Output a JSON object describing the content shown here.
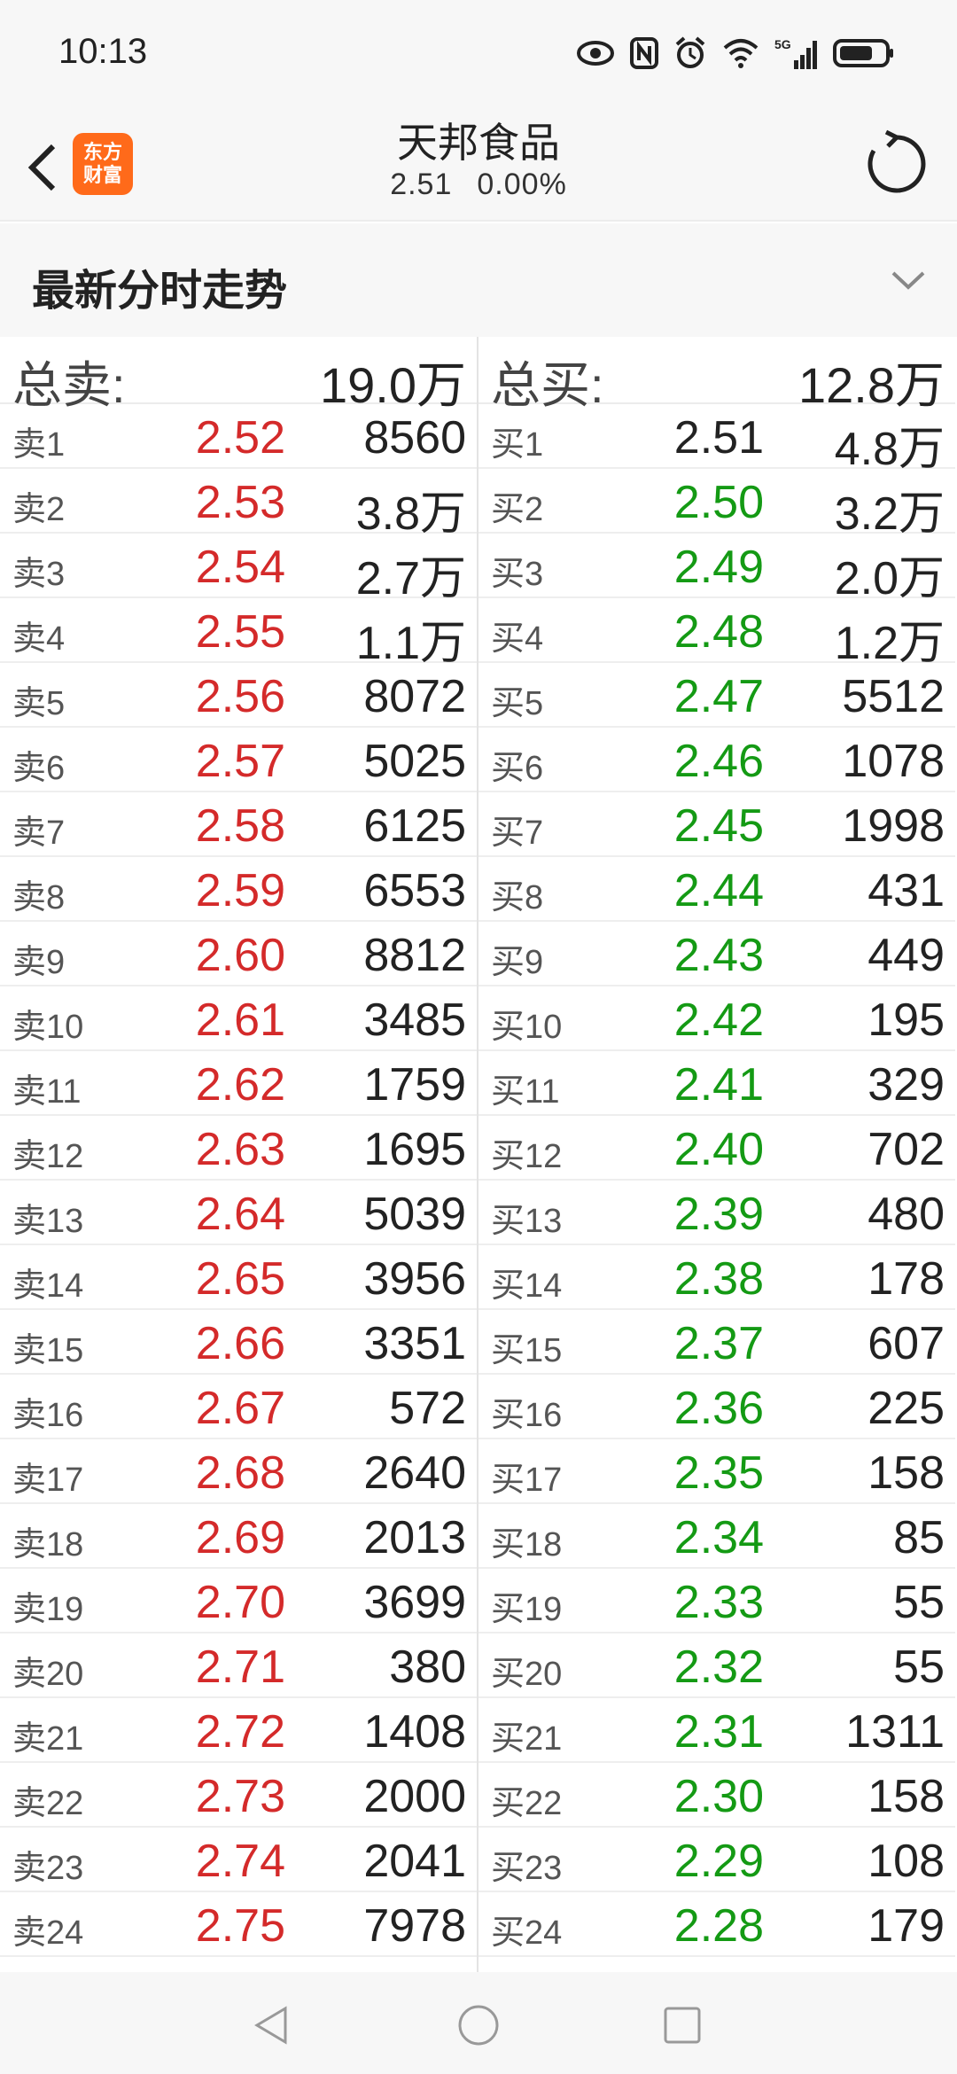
{
  "status_bar": {
    "time": "10:13",
    "icons": [
      "eye-icon",
      "nfc-icon",
      "alarm-icon",
      "wifi-icon",
      "signal-5g-icon",
      "battery-icon"
    ]
  },
  "header": {
    "logo_line1": "东方",
    "logo_line2": "财富",
    "stock_name": "天邦食品",
    "price": "2.51",
    "change_pct": "0.00%"
  },
  "section": {
    "title": "最新分时走势"
  },
  "order_book": {
    "sell_total_label": "总卖:",
    "sell_total_value": "19.0万",
    "buy_total_label": "总买:",
    "buy_total_value": "12.8万",
    "sell": [
      {
        "label": "卖1",
        "price": "2.52",
        "volume": "8560"
      },
      {
        "label": "卖2",
        "price": "2.53",
        "volume": "3.8万"
      },
      {
        "label": "卖3",
        "price": "2.54",
        "volume": "2.7万"
      },
      {
        "label": "卖4",
        "price": "2.55",
        "volume": "1.1万"
      },
      {
        "label": "卖5",
        "price": "2.56",
        "volume": "8072"
      },
      {
        "label": "卖6",
        "price": "2.57",
        "volume": "5025"
      },
      {
        "label": "卖7",
        "price": "2.58",
        "volume": "6125"
      },
      {
        "label": "卖8",
        "price": "2.59",
        "volume": "6553"
      },
      {
        "label": "卖9",
        "price": "2.60",
        "volume": "8812"
      },
      {
        "label": "卖10",
        "price": "2.61",
        "volume": "3485"
      },
      {
        "label": "卖11",
        "price": "2.62",
        "volume": "1759"
      },
      {
        "label": "卖12",
        "price": "2.63",
        "volume": "1695"
      },
      {
        "label": "卖13",
        "price": "2.64",
        "volume": "5039"
      },
      {
        "label": "卖14",
        "price": "2.65",
        "volume": "3956"
      },
      {
        "label": "卖15",
        "price": "2.66",
        "volume": "3351"
      },
      {
        "label": "卖16",
        "price": "2.67",
        "volume": "572"
      },
      {
        "label": "卖17",
        "price": "2.68",
        "volume": "2640"
      },
      {
        "label": "卖18",
        "price": "2.69",
        "volume": "2013"
      },
      {
        "label": "卖19",
        "price": "2.70",
        "volume": "3699"
      },
      {
        "label": "卖20",
        "price": "2.71",
        "volume": "380"
      },
      {
        "label": "卖21",
        "price": "2.72",
        "volume": "1408"
      },
      {
        "label": "卖22",
        "price": "2.73",
        "volume": "2000"
      },
      {
        "label": "卖23",
        "price": "2.74",
        "volume": "2041"
      },
      {
        "label": "卖24",
        "price": "2.75",
        "volume": "7978"
      }
    ],
    "buy": [
      {
        "label": "买1",
        "price": "2.51",
        "volume": "4.8万",
        "color": "black"
      },
      {
        "label": "买2",
        "price": "2.50",
        "volume": "3.2万",
        "color": "green"
      },
      {
        "label": "买3",
        "price": "2.49",
        "volume": "2.0万",
        "color": "green"
      },
      {
        "label": "买4",
        "price": "2.48",
        "volume": "1.2万",
        "color": "green"
      },
      {
        "label": "买5",
        "price": "2.47",
        "volume": "5512",
        "color": "green"
      },
      {
        "label": "买6",
        "price": "2.46",
        "volume": "1078",
        "color": "green"
      },
      {
        "label": "买7",
        "price": "2.45",
        "volume": "1998",
        "color": "green"
      },
      {
        "label": "买8",
        "price": "2.44",
        "volume": "431",
        "color": "green"
      },
      {
        "label": "买9",
        "price": "2.43",
        "volume": "449",
        "color": "green"
      },
      {
        "label": "买10",
        "price": "2.42",
        "volume": "195",
        "color": "green"
      },
      {
        "label": "买11",
        "price": "2.41",
        "volume": "329",
        "color": "green"
      },
      {
        "label": "买12",
        "price": "2.40",
        "volume": "702",
        "color": "green"
      },
      {
        "label": "买13",
        "price": "2.39",
        "volume": "480",
        "color": "green"
      },
      {
        "label": "买14",
        "price": "2.38",
        "volume": "178",
        "color": "green"
      },
      {
        "label": "买15",
        "price": "2.37",
        "volume": "607",
        "color": "green"
      },
      {
        "label": "买16",
        "price": "2.36",
        "volume": "225",
        "color": "green"
      },
      {
        "label": "买17",
        "price": "2.35",
        "volume": "158",
        "color": "green"
      },
      {
        "label": "买18",
        "price": "2.34",
        "volume": "85",
        "color": "green"
      },
      {
        "label": "买19",
        "price": "2.33",
        "volume": "55",
        "color": "green"
      },
      {
        "label": "买20",
        "price": "2.32",
        "volume": "55",
        "color": "green"
      },
      {
        "label": "买21",
        "price": "2.31",
        "volume": "1311",
        "color": "green"
      },
      {
        "label": "买22",
        "price": "2.30",
        "volume": "158",
        "color": "green"
      },
      {
        "label": "买23",
        "price": "2.29",
        "volume": "108",
        "color": "green"
      },
      {
        "label": "买24",
        "price": "2.28",
        "volume": "179",
        "color": "green"
      }
    ]
  },
  "colors": {
    "sell_price": "#d42a2a",
    "buy_price": "#149a14",
    "logo_bg": "#ff6a1a"
  },
  "nav_bar": {
    "buttons": [
      "back-triangle-icon",
      "home-circle-icon",
      "recents-square-icon"
    ]
  }
}
